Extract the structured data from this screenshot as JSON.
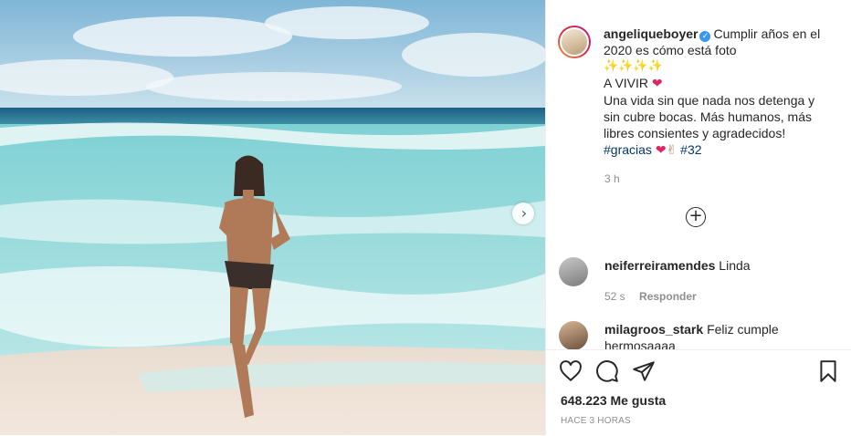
{
  "post": {
    "username": "angeliqueboyer",
    "caption_lines": [
      "Cumplir años en el",
      "2020 es cómo está foto"
    ],
    "sparkles": "✨✨✨✨",
    "line_a_vivir": "A VIVIR",
    "body_lines": [
      "Una vida sin que nada nos detenga y",
      "sin cubre bocas. Más humanos, más",
      "libres consientes y agradecidos!"
    ],
    "hashtag": "#gracias",
    "number_tag": "#32",
    "time": "3 h"
  },
  "comments": [
    {
      "username": "neiferreiramendes",
      "text": "Linda",
      "time": "52 s",
      "reply_label": "Responder"
    },
    {
      "username": "milagroos_stark",
      "text": "Feliz cumple",
      "text2": "hermosaaaa"
    }
  ],
  "footer": {
    "likes_count": "648.223",
    "likes_label": "Me gusta",
    "posted_ago": "HACE 3 HORAS"
  },
  "icons": {
    "like": "heart-icon",
    "comment": "comment-icon",
    "share": "paper-plane-icon",
    "save": "bookmark-icon",
    "next": "chevron-right-icon",
    "load_more": "plus-circle-icon"
  },
  "colors": {
    "link": "#00376b",
    "verified": "#3897f0",
    "muted": "#8e8e8e",
    "text": "#262626"
  }
}
